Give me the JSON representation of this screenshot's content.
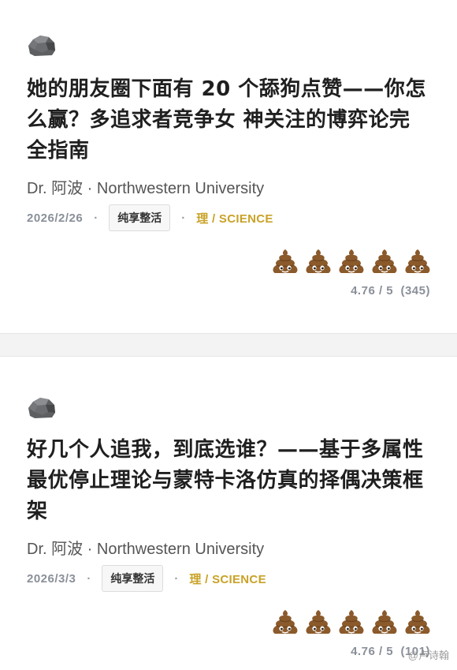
{
  "colors": {
    "title": "#1f1f1f",
    "meta_gray": "#8a8f99",
    "subject_gold": "#c9a227",
    "divider": "#f3f3f3",
    "poop_brown": "#8b5a2b"
  },
  "articles": [
    {
      "icon": "rock-icon",
      "title": "她的朋友圈下面有 20 个舔狗点赞——你怎么赢？多追求者竞争女 神关注的博弈论完全指南",
      "author": "Dr. 阿波 · Northwestern University",
      "date": "2026/2/26",
      "tag": "纯享整活",
      "subject": "理 / SCIENCE",
      "rating_icon": "poop-emoji-icon",
      "rating_count_icons": 5,
      "rating_value": 4.76,
      "rating_text": "4.76 / 5  (345)"
    },
    {
      "icon": "rock-icon",
      "title": "好几个人追我，到底选谁？——基于多属性最优停止理论与蒙特卡洛仿真的择偶决策框架",
      "author": "Dr. 阿波 · Northwestern University",
      "date": "2026/3/3",
      "tag": "纯享整活",
      "subject": "理 / SCIENCE",
      "rating_icon": "poop-emoji-icon",
      "rating_count_icons": 5,
      "rating_value": 4.76,
      "rating_text": "4.76 / 5  (101)"
    }
  ],
  "separator": "·",
  "watermark": "@卢诗翰"
}
